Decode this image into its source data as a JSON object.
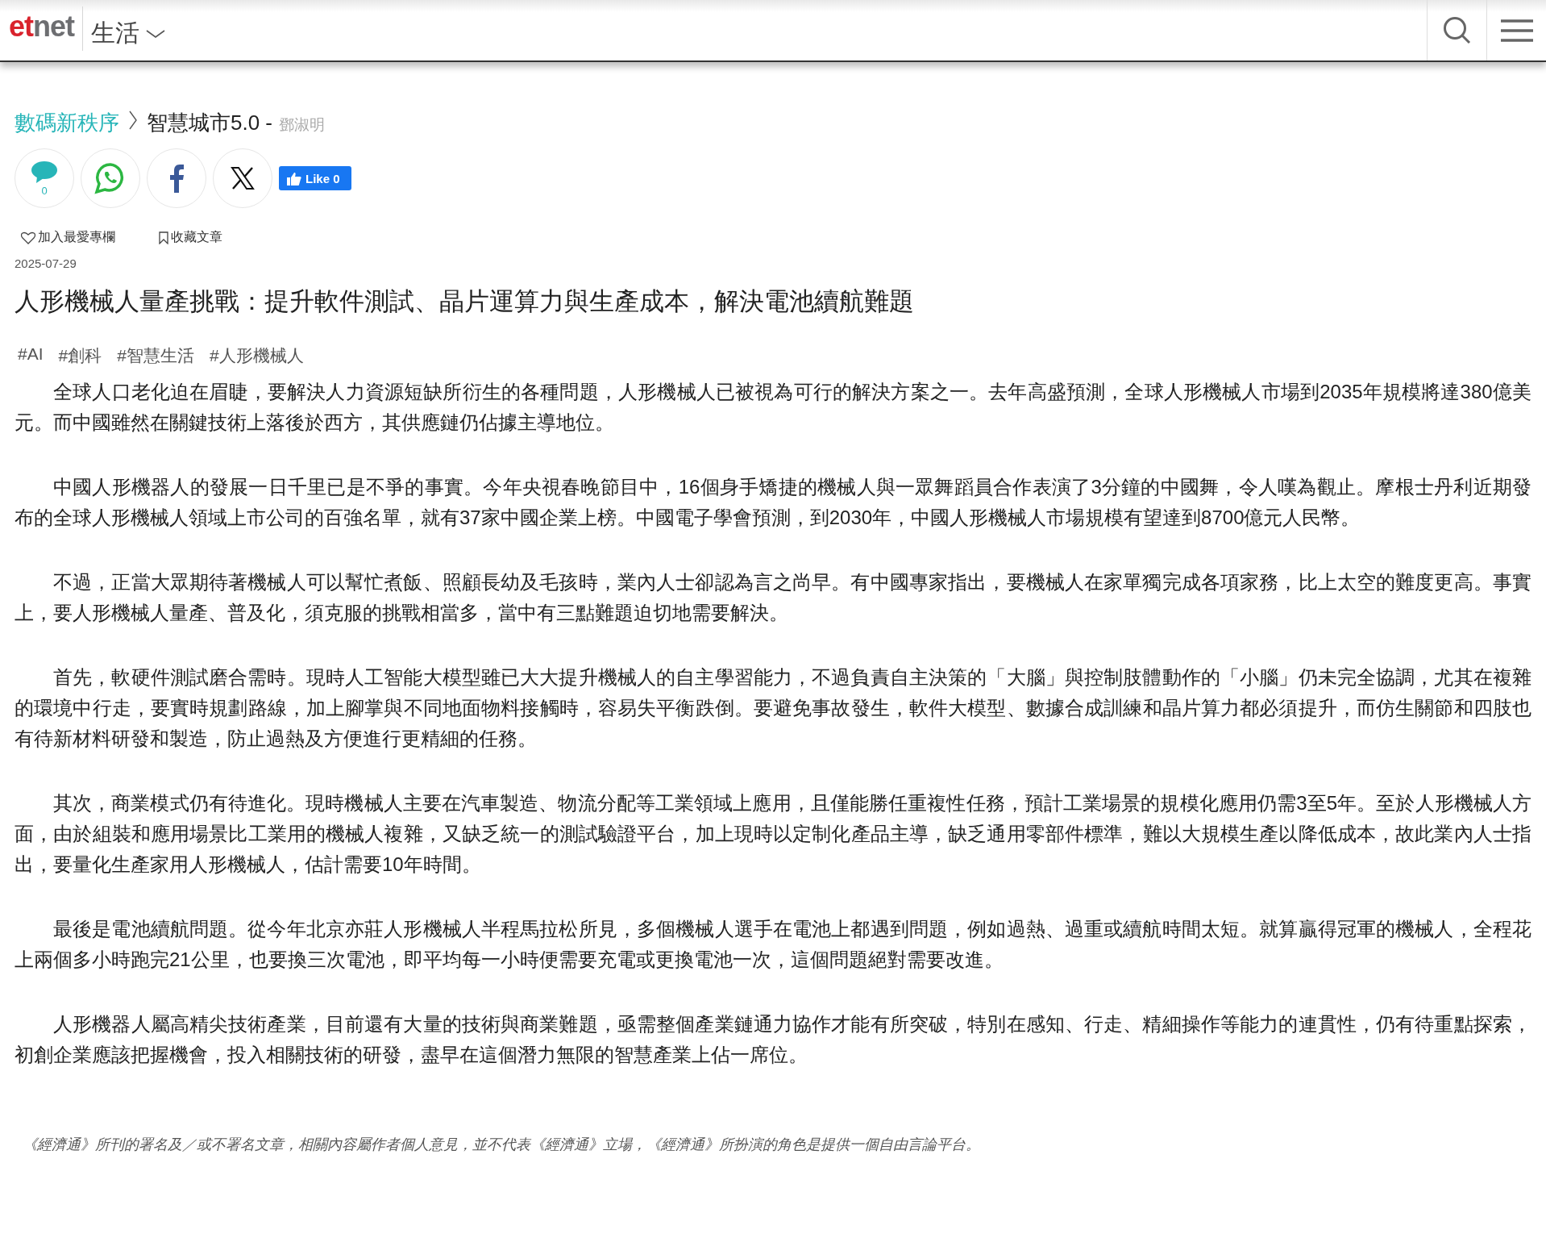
{
  "header": {
    "logo": {
      "part_1": "et",
      "part_2": "net"
    },
    "section": "生活"
  },
  "breadcrumb": {
    "column": "數碼新秩序",
    "series": "智慧城市5.0 -",
    "author": "鄧淑明"
  },
  "share": {
    "comment_count": "0",
    "like_label": "Like 0"
  },
  "actions": [
    {
      "kind": "heart",
      "label": "加入最愛專欄"
    },
    {
      "kind": "bookmark",
      "label": "收藏文章"
    }
  ],
  "date": "2025-07-29",
  "title": "人形機械人量產挑戰：提升軟件測試、晶片運算力與生產成本，解決電池續航難題",
  "tags": [
    "#AI",
    "#創科",
    "#智慧生活",
    "#人形機械人"
  ],
  "paragraphs": [
    "全球人口老化迫在眉睫，要解決人力資源短缺所衍生的各種問題，人形機械人已被視為可行的解決方案之一。去年高盛預測，全球人形機械人市場到2035年規模將達380億美元。而中國雖然在關鍵技術上落後於西方，其供應鏈仍佔據主導地位。",
    "中國人形機器人的發展一日千里已是不爭的事實。今年央視春晚節目中，16個身手矯捷的機械人與一眾舞蹈員合作表演了3分鐘的中國舞，令人嘆為觀止。摩根士丹利近期發布的全球人形機械人領域上市公司的百強名單，就有37家中國企業上榜。中國電子學會預測，到2030年，中國人形機械人市場規模有望達到8700億元人民幣。",
    "不過，正當大眾期待著機械人可以幫忙煮飯、照顧長幼及毛孩時，業內人士卻認為言之尚早。有中國專家指出，要機械人在家單獨完成各項家務，比上太空的難度更高。事實上，要人形機械人量產、普及化，須克服的挑戰相當多，當中有三點難題迫切地需要解決。",
    "首先，軟硬件測試磨合需時。現時人工智能大模型雖已大大提升機械人的自主學習能力，不過負責自主決策的「大腦」與控制肢體動作的「小腦」仍未完全協調，尤其在複雜的環境中行走，要實時規劃路線，加上腳掌與不同地面物料接觸時，容易失平衡跌倒。要避免事故發生，軟件大模型、數據合成訓練和晶片算力都必須提升，而仿生關節和四肢也有待新材料研發和製造，防止過熱及方便進行更精細的任務。",
    "其次，商業模式仍有待進化。現時機械人主要在汽車製造、物流分配等工業領域上應用，且僅能勝任重複性任務，預計工業場景的規模化應用仍需3至5年。至於人形機械人方面，由於組裝和應用場景比工業用的機械人複雜，又缺乏統一的測試驗證平台，加上現時以定制化產品主導，缺乏通用零部件標準，難以大規模生產以降低成本，故此業內人士指出，要量化生產家用人形機械人，估計需要10年時間。",
    "最後是電池續航問題。從今年北京亦莊人形機械人半程馬拉松所見，多個機械人選手在電池上都遇到問題，例如過熱、過重或續航時間太短。就算贏得冠軍的機械人，全程花上兩個多小時跑完21公里，也要換三次電池，即平均每一小時便需要充電或更換電池一次，這個問題絕對需要改進。",
    "人形機器人屬高精尖技術產業，目前還有大量的技術與商業難題，亟需整個產業鏈通力協作才能有所突破，特別在感知、行走、精細操作等能力的連貫性，仍有待重點探索，初創企業應該把握機會，投入相關技術的研發，盡早在這個潛力無限的智慧產業上佔一席位。"
  ],
  "disclaimer": "《經濟通》所刊的署名及／或不署名文章，相關內容屬作者個人意見，並不代表《經濟通》立場，《經濟通》所扮演的角色是提供一個自由言論平台。"
}
